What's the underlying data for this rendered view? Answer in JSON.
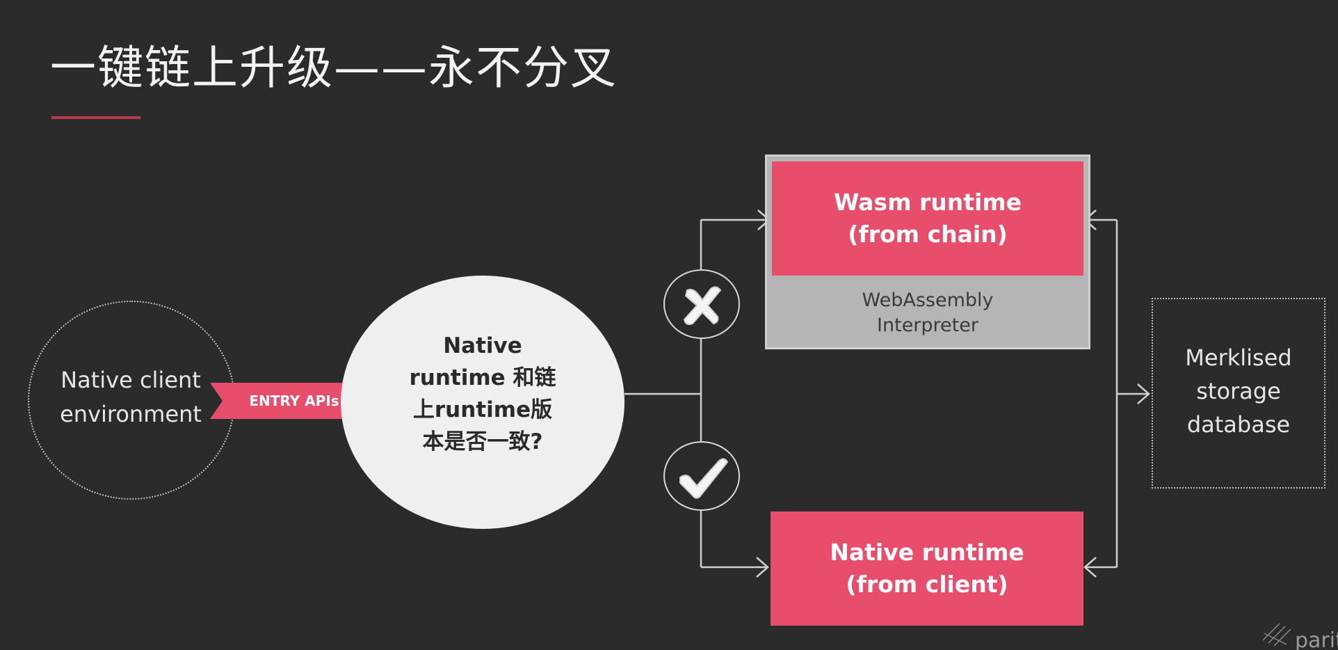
{
  "slide": {
    "title": "一键链上升级——永不分叉"
  },
  "diagram": {
    "client": {
      "label_line1": "Native client",
      "label_line2": "environment"
    },
    "entry": {
      "label": "ENTRY APIs"
    },
    "decision": {
      "line1": "Native",
      "line2": "runtime 和链",
      "line3": "上runtime版",
      "line4": "本是否一致?"
    },
    "wasm_runtime": {
      "line1": "Wasm runtime",
      "line2": "(from chain)"
    },
    "interpreter": {
      "line1": "WebAssembly",
      "line2": "Interpreter"
    },
    "native_runtime": {
      "line1": "Native runtime",
      "line2": "(from client)"
    },
    "storage": {
      "line1": "Merklised",
      "line2": "storage",
      "line3": "database"
    },
    "marks": {
      "mismatch_icon": "x-mark-icon",
      "match_icon": "check-mark-icon"
    }
  },
  "footer": {
    "logo_text": "parity"
  },
  "colors": {
    "background": "#2b2b2b",
    "accent_red": "#e84e6c",
    "interpreter_gray": "#b5b5b5",
    "decision_fill": "#efefef",
    "line_color": "#d0d0d0"
  }
}
